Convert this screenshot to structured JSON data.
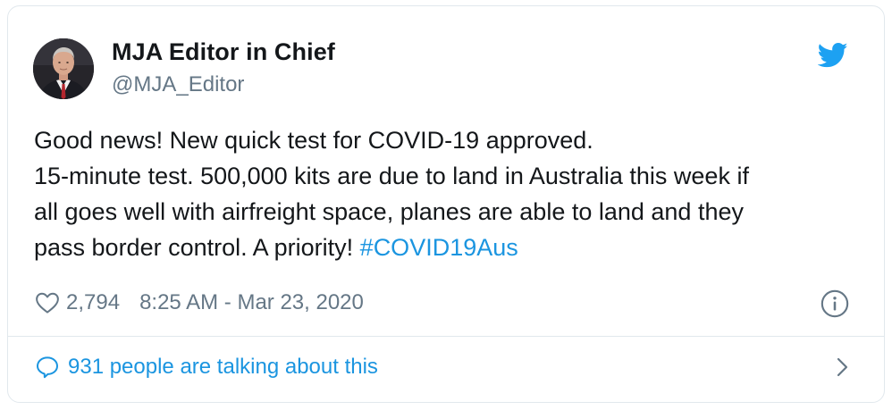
{
  "tweet": {
    "author_name": "MJA Editor in Chief",
    "author_handle": "@MJA_Editor",
    "text_lines": [
      "Good news! New quick test for COVID-19 approved.",
      "15-minute test. 500,000 kits are due to land in Australia this week if",
      "all goes well with airfreight space, planes are able to land and they",
      "pass border control. A priority! "
    ],
    "hashtag": "#COVID19Aus",
    "likes": "2,794",
    "timestamp": "8:25 AM - Mar 23, 2020",
    "talking_about": "931 people are talking about this"
  },
  "icons": {
    "brand": "twitter-bird-icon",
    "like": "heart-icon",
    "info": "info-icon",
    "reply": "speech-bubble-icon",
    "more": "chevron-right-icon"
  },
  "colors": {
    "twitter_blue": "#1da1f2",
    "link_blue": "#1b95e0",
    "muted_gray": "#657786",
    "text": "#14171a",
    "border": "#e1e8ed"
  }
}
